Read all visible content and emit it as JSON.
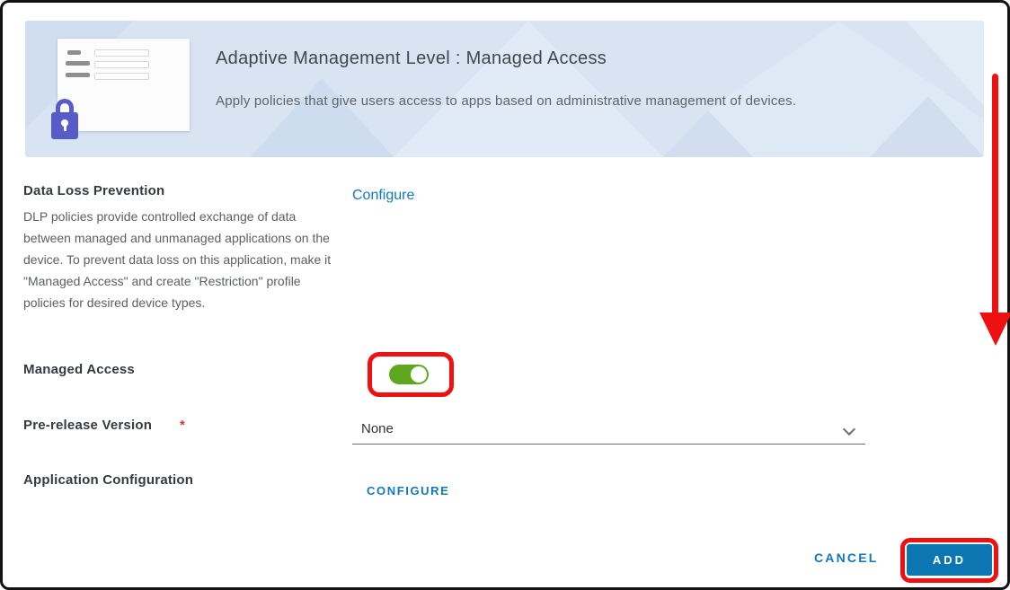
{
  "banner": {
    "title": "Adaptive Management Level : Managed Access",
    "subtitle": "Apply policies that give users access to apps based on administrative management of devices.",
    "icon": "app-policy-lock-icon",
    "background_color": "#d8e4f2"
  },
  "form": {
    "dlp": {
      "label": "Data Loss Prevention",
      "description": "DLP policies provide controlled exchange of data between managed and unmanaged applications on the device. To prevent data loss on this application, make it \"Managed Access\" and create \"Restriction\" profile policies for desired device types.",
      "action": "Configure"
    },
    "managed_access": {
      "label": "Managed Access",
      "toggle_state": "on"
    },
    "prerelease_version": {
      "label": "Pre-release Version",
      "required_marker": "*",
      "value": "None"
    },
    "application_configuration": {
      "label": "Application Configuration",
      "action": "CONFIGURE"
    }
  },
  "footer": {
    "cancel": "CANCEL",
    "add": "ADD"
  },
  "colors": {
    "link_blue": "#1379bf",
    "primary_button_blue": "#0b76b2",
    "toggle_green": "#5ea71f",
    "annotation_red": "#ee1111",
    "lock_purple": "#585cc8",
    "required_red": "#e0352b",
    "banner_blue": "#d8e4f2"
  },
  "annotations": {
    "arrow": "red-down-arrow",
    "toggle_highlight": "red-outline-around-toggle",
    "add_highlight": "red-outline-around-add-button"
  }
}
